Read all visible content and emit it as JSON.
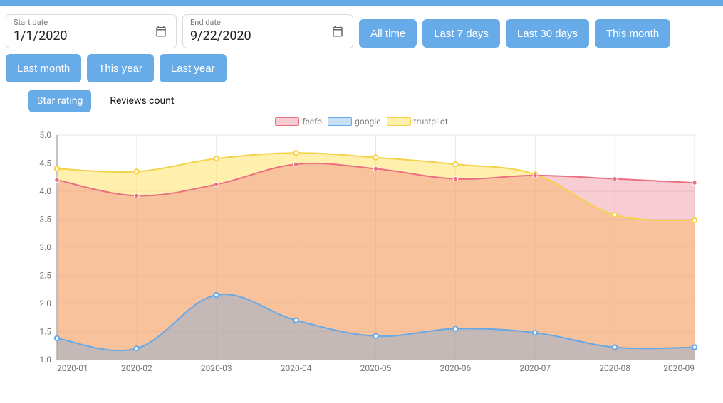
{
  "date_range": {
    "start_label": "Start date",
    "start_value": "1/1/2020",
    "end_label": "End date",
    "end_value": "9/22/2020"
  },
  "quick_ranges": {
    "all_time": "All time",
    "last_7": "Last 7 days",
    "last_30": "Last 30 days",
    "this_month": "This month",
    "last_month": "Last month",
    "this_year": "This year",
    "last_year": "Last year"
  },
  "tabs": {
    "star_rating": "Star rating",
    "reviews_count": "Reviews count",
    "active": "star_rating"
  },
  "legend": {
    "feefo": "feefo",
    "google": "google",
    "trustpilot": "trustpilot"
  },
  "chart_data": {
    "type": "area",
    "title": "",
    "xlabel": "",
    "ylabel": "",
    "ylim": [
      1.0,
      5.0
    ],
    "x_ticks": [
      "2020-01",
      "2020-02",
      "2020-03",
      "2020-04",
      "2020-05",
      "2020-06",
      "2020-07",
      "2020-08",
      "2020-09"
    ],
    "y_ticks": [
      1.0,
      1.5,
      2.0,
      2.5,
      3.0,
      3.5,
      4.0,
      4.5,
      5.0
    ],
    "categories": [
      "2020-01",
      "2020-02",
      "2020-03",
      "2020-04",
      "2020-05",
      "2020-06",
      "2020-07",
      "2020-08",
      "2020-09"
    ],
    "series": [
      {
        "name": "feefo",
        "color": "#ec6e81",
        "values": [
          4.2,
          3.92,
          4.12,
          4.48,
          4.4,
          4.22,
          4.28,
          4.22,
          4.15
        ]
      },
      {
        "name": "google",
        "color": "#64a8e8",
        "values": [
          1.38,
          1.2,
          2.15,
          1.7,
          1.42,
          1.55,
          1.48,
          1.22,
          1.22
        ]
      },
      {
        "name": "trustpilot",
        "color": "#f4d24a",
        "values": [
          4.4,
          4.35,
          4.58,
          4.68,
          4.6,
          4.48,
          4.3,
          3.58,
          3.48
        ]
      }
    ]
  }
}
